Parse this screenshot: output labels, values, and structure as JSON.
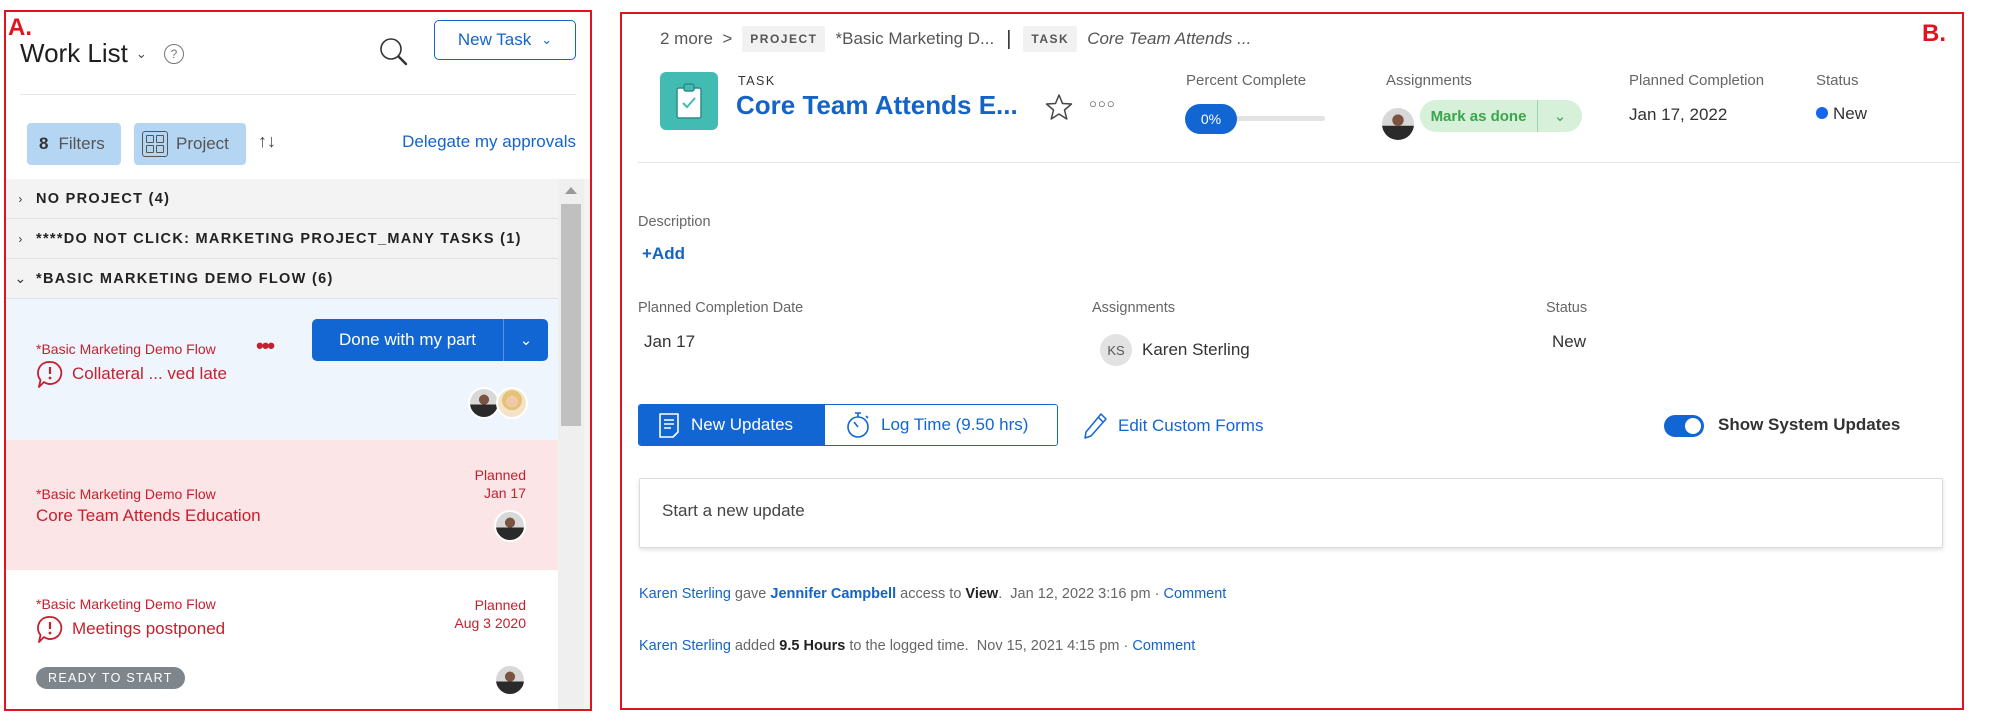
{
  "annotations": {
    "panel_a_label": "A.",
    "panel_b_label": "B."
  },
  "worklist": {
    "title": "Work List",
    "help_icon": "question-circle-icon",
    "search_icon": "search-icon",
    "new_task_label": "New Task",
    "filters_count": "8",
    "filters_label": "Filters",
    "group_by_label": "Project",
    "sort_icon": "sort-arrows-icon",
    "delegate_label": "Delegate my approvals",
    "groups": [
      {
        "label": "NO PROJECT (4)",
        "expanded": false
      },
      {
        "label": "****DO NOT CLICK: MARKETING PROJECT_MANY TASKS (1)",
        "expanded": false
      },
      {
        "label": "*BASIC MARKETING DEMO FLOW (6)",
        "expanded": true
      }
    ],
    "tasks": [
      {
        "project": "*Basic Marketing Demo Flow",
        "name": "Collateral ... ved late",
        "has_issue_icon": true,
        "primary_action": "Done with my part",
        "assignees": [
          "avatar-woman-dark-hair",
          "avatar-woman-blonde"
        ],
        "state": "selected"
      },
      {
        "project": "*Basic Marketing Demo Flow",
        "name": "Core Team Attends Education",
        "planned_label": "Planned",
        "planned_date": "Jan 17",
        "assignees": [
          "avatar-woman-dark-hair"
        ],
        "state": "overdue-active"
      },
      {
        "project": "*Basic Marketing Demo Flow",
        "name": "Meetings postponed",
        "has_issue_icon": true,
        "planned_label": "Planned",
        "planned_date": "Aug 3 2020",
        "badge": "READY TO START",
        "assignees": [
          "avatar-woman-dark-hair"
        ],
        "state": "normal"
      }
    ]
  },
  "detail": {
    "breadcrumb": {
      "more": "2 more",
      "project_pill": "PROJECT",
      "project_name": "*Basic Marketing D...",
      "task_pill": "TASK",
      "task_name": "Core Team Attends ..."
    },
    "object_type": "TASK",
    "title": "Core Team Attends E...",
    "percent_complete_label": "Percent Complete",
    "percent_complete": 0,
    "percent_complete_text": "0%",
    "assignments_label": "Assignments",
    "mark_done_label": "Mark as done",
    "planned_completion_label": "Planned Completion",
    "planned_completion": "Jan 17, 2022",
    "status_label": "Status",
    "status": "New",
    "status_color": "#1266f0",
    "fields": {
      "description_label": "Description",
      "add_label": "+Add",
      "planned_completion_date_label": "Planned Completion Date",
      "planned_completion_date": "Jan 17",
      "assignments_label": "Assignments",
      "assignee_initials": "KS",
      "assignee_name": "Karen Sterling",
      "status_label": "Status",
      "status": "New"
    },
    "tabs": [
      {
        "label": "New Updates",
        "active": true,
        "icon": "document-icon"
      },
      {
        "label": "Log Time (9.50 hrs)",
        "active": false,
        "icon": "stopwatch-icon"
      }
    ],
    "edit_custom_forms_label": "Edit Custom Forms",
    "show_system_updates_label": "Show System Updates",
    "show_system_updates": true,
    "update_placeholder": "Start a new update",
    "feed": [
      {
        "actor": "Karen Sterling",
        "verb": "gave",
        "target": "Jennifer Campbell",
        "middle": "access to",
        "object": "View",
        "end": ".",
        "timestamp": "Jan 12, 2022 3:16 pm",
        "sep": "·",
        "comment_label": "Comment"
      },
      {
        "actor": "Karen Sterling",
        "verb": "added",
        "object": "9.5 Hours",
        "middle": "to the logged time.",
        "timestamp": "Nov 15, 2021 4:15 pm",
        "sep": "·",
        "comment_label": "Comment"
      }
    ]
  },
  "colors": {
    "brand_blue": "#1266d3",
    "overdue_red": "#c5202e",
    "task_teal": "#42bbb3",
    "success_green": "#3aa64c"
  }
}
